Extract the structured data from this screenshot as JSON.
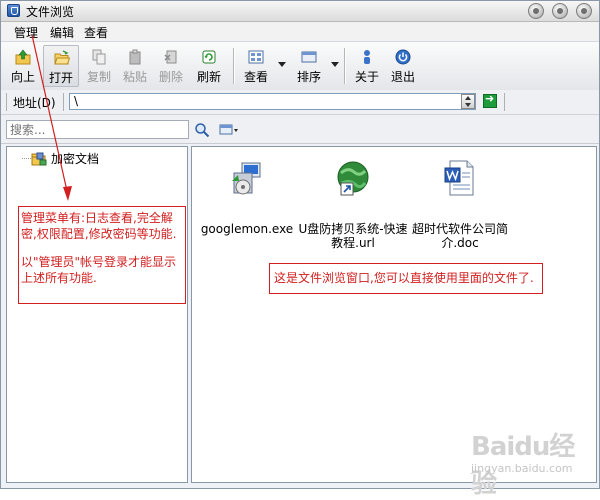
{
  "window": {
    "title": "文件浏览"
  },
  "menu": {
    "items": [
      "管理",
      "编辑",
      "查看"
    ]
  },
  "toolbar": {
    "up": "向上",
    "open": "打开",
    "copy": "复制",
    "paste": "粘贴",
    "delete": "删除",
    "refresh": "刷新",
    "view": "查看",
    "sort": "排序",
    "about": "关于",
    "exit": "退出"
  },
  "address": {
    "label": "地址(D)",
    "value": "\\"
  },
  "search": {
    "placeholder": "搜索..."
  },
  "tree": {
    "root": "加密文档"
  },
  "files": [
    {
      "name": "googlemon.exe",
      "icon": "installer-icon"
    },
    {
      "name": "U盘防拷贝系统-快速教程.url",
      "icon": "internet-shortcut-icon"
    },
    {
      "name": "超时代软件公司简介.doc",
      "icon": "word-document-icon"
    }
  ],
  "annotations": {
    "menu_note_1": "管理菜单有:日志查看,完全解密,权限配置,修改密码等功能.",
    "menu_note_2": "以\"管理员\"帐号登录才能显示上述所有功能.",
    "window_note": "这是文件浏览窗口,您可以直接使用里面的文件了."
  },
  "watermark": {
    "brand": "Baidu经验",
    "site": "jingyan.baidu.com"
  },
  "colors": {
    "annotation": "#d21f1f",
    "accent": "#1f55a8"
  }
}
